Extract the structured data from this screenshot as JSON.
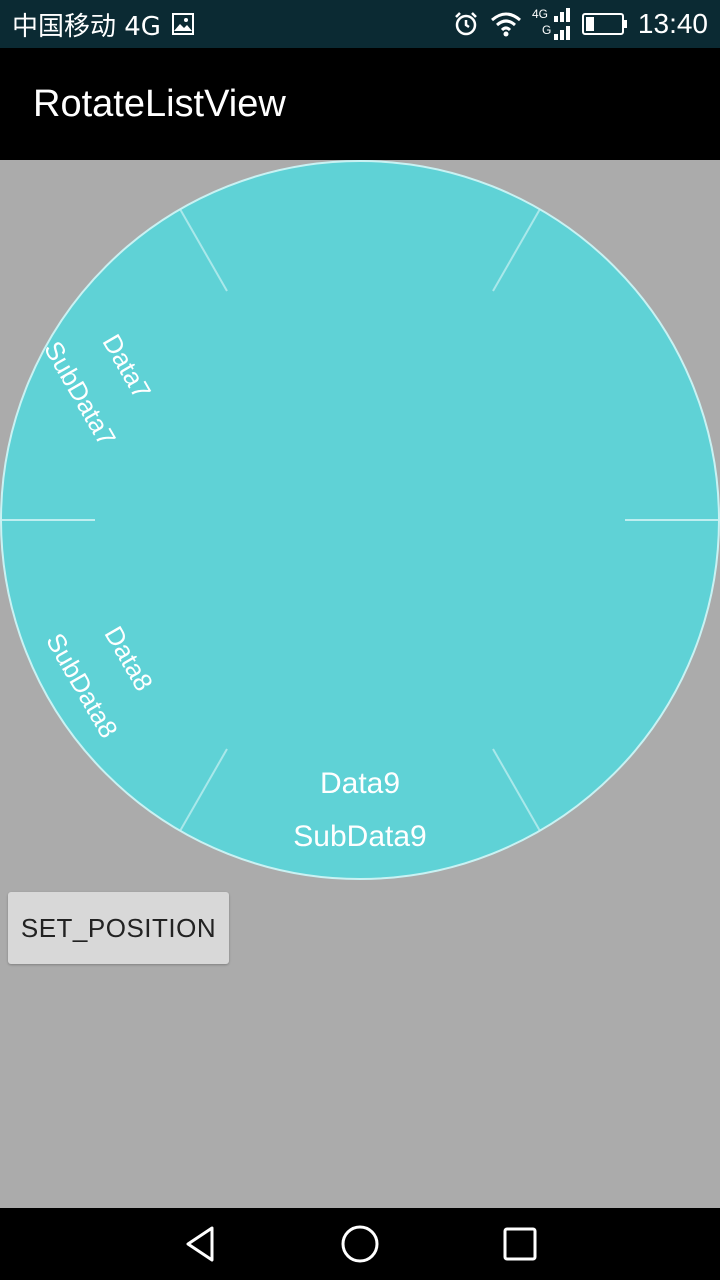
{
  "status_bar": {
    "carrier": "中国移动 4G",
    "network_small": "4G",
    "time": "13:40",
    "icons": [
      "image-icon",
      "alarm-icon",
      "wifi-icon",
      "signal-icon",
      "battery-icon"
    ]
  },
  "app_bar": {
    "title": "RotateListView"
  },
  "wheel": {
    "fill_color": "#5fd2d6",
    "divider_color": "#c9f2f3",
    "items": [
      {
        "title": "Data7",
        "subtitle": "SubData7"
      },
      {
        "title": "Data8",
        "subtitle": "SubData8"
      },
      {
        "title": "Data9",
        "subtitle": "SubData9"
      }
    ]
  },
  "button": {
    "label": "SET_POSITION"
  },
  "nav_bar": {
    "icons": [
      "back-icon",
      "home-icon",
      "recents-icon"
    ]
  }
}
